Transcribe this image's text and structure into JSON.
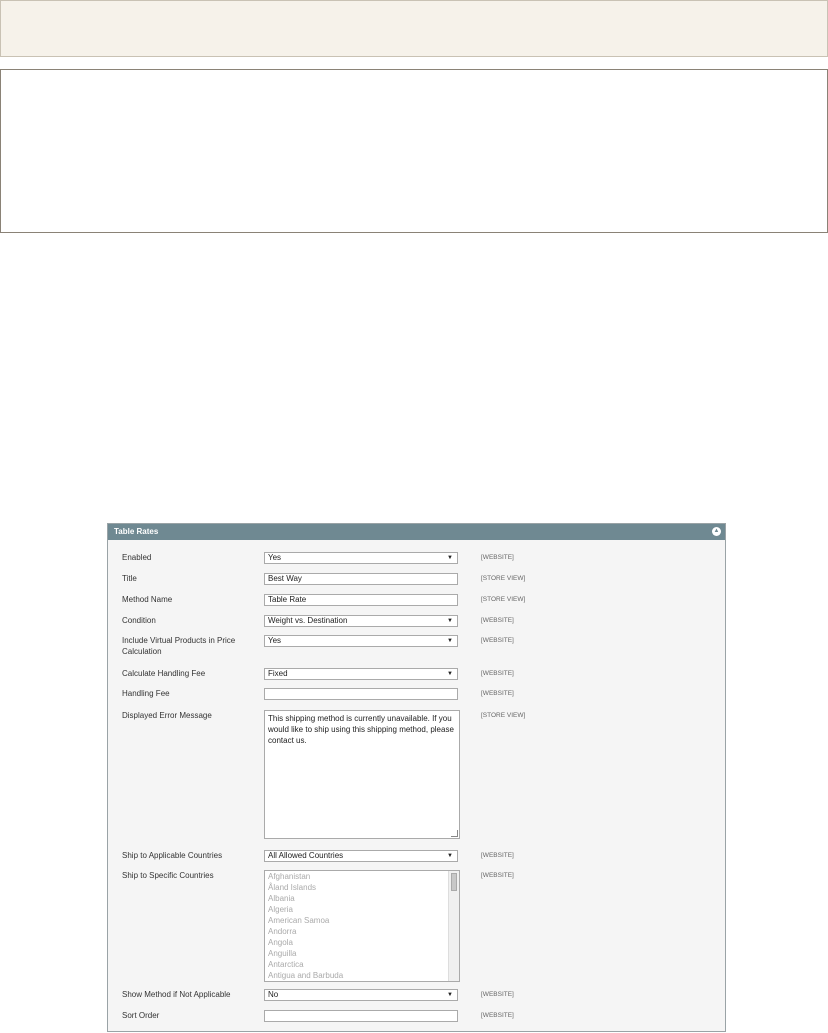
{
  "section": {
    "title": "Table Rates",
    "collapse_icon": "collapse-up-icon"
  },
  "fields": {
    "enabled": {
      "label": "Enabled",
      "value": "Yes",
      "scope": "[WEBSITE]"
    },
    "title": {
      "label": "Title",
      "value": "Best Way",
      "scope": "[STORE VIEW]"
    },
    "method_name": {
      "label": "Method Name",
      "value": "Table Rate",
      "scope": "[STORE VIEW]"
    },
    "condition": {
      "label": "Condition",
      "value": "Weight vs. Destination",
      "scope": "[WEBSITE]"
    },
    "include_virtual": {
      "label": "Include Virtual Products in Price Calculation",
      "value": "Yes",
      "scope": "[WEBSITE]"
    },
    "calc_handling_fee": {
      "label": "Calculate Handling Fee",
      "value": "Fixed",
      "scope": "[WEBSITE]"
    },
    "handling_fee": {
      "label": "Handling Fee",
      "value": "",
      "scope": "[WEBSITE]"
    },
    "error_message": {
      "label": "Displayed Error Message",
      "value": "This shipping method is currently unavailable. If you would like to ship using this shipping method, please contact us.",
      "scope": "[STORE VIEW]"
    },
    "applicable_countries": {
      "label": "Ship to Applicable Countries",
      "value": "All Allowed Countries",
      "scope": "[WEBSITE]"
    },
    "specific_countries": {
      "label": "Ship to Specific Countries",
      "scope": "[WEBSITE]",
      "options": [
        "Afghanistan",
        "Åland Islands",
        "Albania",
        "Algeria",
        "American Samoa",
        "Andorra",
        "Angola",
        "Anguilla",
        "Antarctica",
        "Antigua and Barbuda"
      ]
    },
    "show_method": {
      "label": "Show Method if Not Applicable",
      "value": "No",
      "scope": "[WEBSITE]"
    },
    "sort_order": {
      "label": "Sort Order",
      "value": "",
      "scope": "[WEBSITE]"
    }
  }
}
